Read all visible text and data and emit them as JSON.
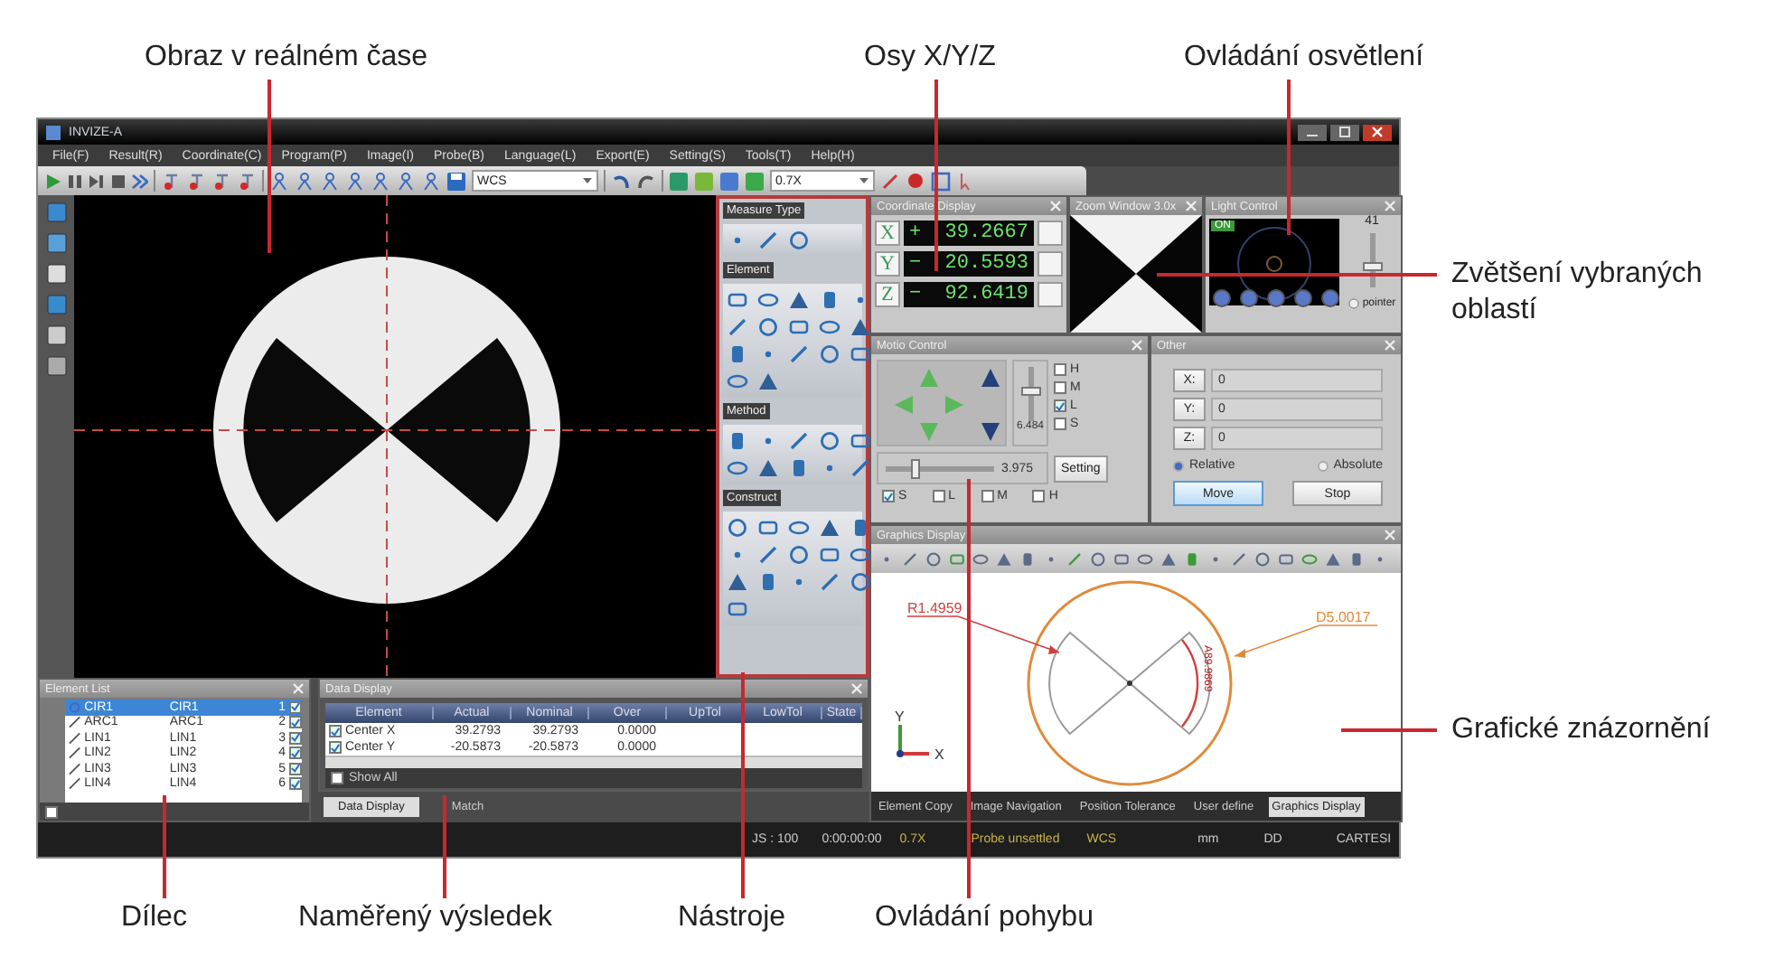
{
  "callouts": [
    {
      "text": "Obraz v reálném čase"
    },
    {
      "text": "Osy X/Y/Z"
    },
    {
      "text": "Ovládání osvětlení"
    },
    {
      "text": "Zvětšení vybraných oblastí"
    },
    {
      "text": "Grafické znázornění"
    },
    {
      "text": "Dílec"
    },
    {
      "text": "Naměřený výsledek"
    },
    {
      "text": "Nástroje"
    },
    {
      "text": "Ovládání pohybu"
    }
  ],
  "window": {
    "title": "INVIZE-A"
  },
  "menu": [
    "File(F)",
    "Result(R)",
    "Coordinate(C)",
    "Program(P)",
    "Image(I)",
    "Probe(B)",
    "Language(L)",
    "Export(E)",
    "Setting(S)",
    "Tools(T)",
    "Help(H)"
  ],
  "toolbar": {
    "coordinate_system": "WCS",
    "magnification": "0.7X"
  },
  "tools_panel": {
    "sections": [
      {
        "title": "Measure Type"
      },
      {
        "title": "Element"
      },
      {
        "title": "Method"
      },
      {
        "title": "Construct"
      }
    ]
  },
  "coordinate_display": {
    "title": "Coordinate Display",
    "axes": [
      {
        "axis": "X",
        "sign": "+",
        "value": "39.2667"
      },
      {
        "axis": "Y",
        "sign": "−",
        "value": "20.5593"
      },
      {
        "axis": "Z",
        "sign": "−",
        "value": "92.6419"
      }
    ]
  },
  "zoom_window": {
    "title": "Zoom Window 3.0x"
  },
  "light_control": {
    "title": "Light Control",
    "badge": "ON",
    "reading": "41",
    "level": 0.35,
    "pointer_label": "pointer"
  },
  "motion_control": {
    "title": "Motio Control",
    "speed_slider": {
      "level": 0.55,
      "reading": "6.484"
    },
    "jog_slider": {
      "level": 0.25,
      "reading": "3.975"
    },
    "setting_button": "Setting",
    "speed_options": [
      {
        "label": "H",
        "checked": false
      },
      {
        "label": "M",
        "checked": false
      },
      {
        "label": "L",
        "checked": true
      },
      {
        "label": "S",
        "checked": false
      }
    ],
    "step_options": [
      {
        "label": "S",
        "checked": true
      },
      {
        "label": "L",
        "checked": false
      },
      {
        "label": "M",
        "checked": false
      },
      {
        "label": "H",
        "checked": false
      }
    ]
  },
  "other": {
    "title": "Other",
    "fields": [
      {
        "label": "X:",
        "value": "0"
      },
      {
        "label": "Y:",
        "value": "0"
      },
      {
        "label": "Z:",
        "value": "0"
      }
    ],
    "modes": [
      {
        "label": "Relative",
        "selected": true
      },
      {
        "label": "Absolute",
        "selected": false
      }
    ],
    "buttons": [
      {
        "label": "Move",
        "kind": "primary"
      },
      {
        "label": "Stop",
        "kind": "default"
      }
    ]
  },
  "graphics_display": {
    "title": "Graphics Display",
    "radius_label": "R1.4959",
    "diameter_label": "D5.0017",
    "angle_label": "A89.9869",
    "x_axis": "X",
    "y_axis": "Y"
  },
  "graphics_tabs": [
    {
      "label": "Element Copy",
      "selected": false
    },
    {
      "label": "Image Navigation",
      "selected": false
    },
    {
      "label": "Position Tolerance",
      "selected": false
    },
    {
      "label": "User define",
      "selected": false
    },
    {
      "label": "Graphics Display",
      "selected": true
    }
  ],
  "element_list": {
    "title": "Element List",
    "rows": [
      {
        "kind": "circle",
        "name": "CIR1",
        "label": "CIR1",
        "index": "1",
        "selected": true,
        "checked": true
      },
      {
        "kind": "line",
        "name": "ARC1",
        "label": "ARC1",
        "index": "2",
        "selected": false,
        "checked": true
      },
      {
        "kind": "line",
        "name": "LIN1",
        "label": "LIN1",
        "index": "3",
        "selected": false,
        "checked": true
      },
      {
        "kind": "line",
        "name": "LIN2",
        "label": "LIN2",
        "index": "4",
        "selected": false,
        "checked": true
      },
      {
        "kind": "line",
        "name": "LIN3",
        "label": "LIN3",
        "index": "5",
        "selected": false,
        "checked": true
      },
      {
        "kind": "line",
        "name": "LIN4",
        "label": "LIN4",
        "index": "6",
        "selected": false,
        "checked": true
      }
    ],
    "footer_checkbox": {
      "checked": false
    }
  },
  "data_display": {
    "title": "Data Display",
    "columns": [
      "Element",
      "Actual",
      "Nominal",
      "Over",
      "UpTol",
      "LowTol",
      "State"
    ],
    "rows": [
      {
        "checked": true,
        "cells": [
          "Center X",
          "39.2793",
          "39.2793",
          "0.0000"
        ]
      },
      {
        "checked": true,
        "cells": [
          "Center Y",
          "-20.5873",
          "-20.5873",
          "0.0000"
        ]
      }
    ],
    "show_all": {
      "label": "Show All",
      "checked": false
    }
  },
  "bottom_tabs": [
    {
      "label": "Data Display",
      "selected": true
    },
    {
      "label": "Match",
      "selected": false
    }
  ],
  "status_bar": [
    "JS : 100",
    "0:00:00:00",
    "0.7X",
    "Probe unsettled",
    "WCS",
    "mm",
    "DD",
    "CARTESI"
  ]
}
